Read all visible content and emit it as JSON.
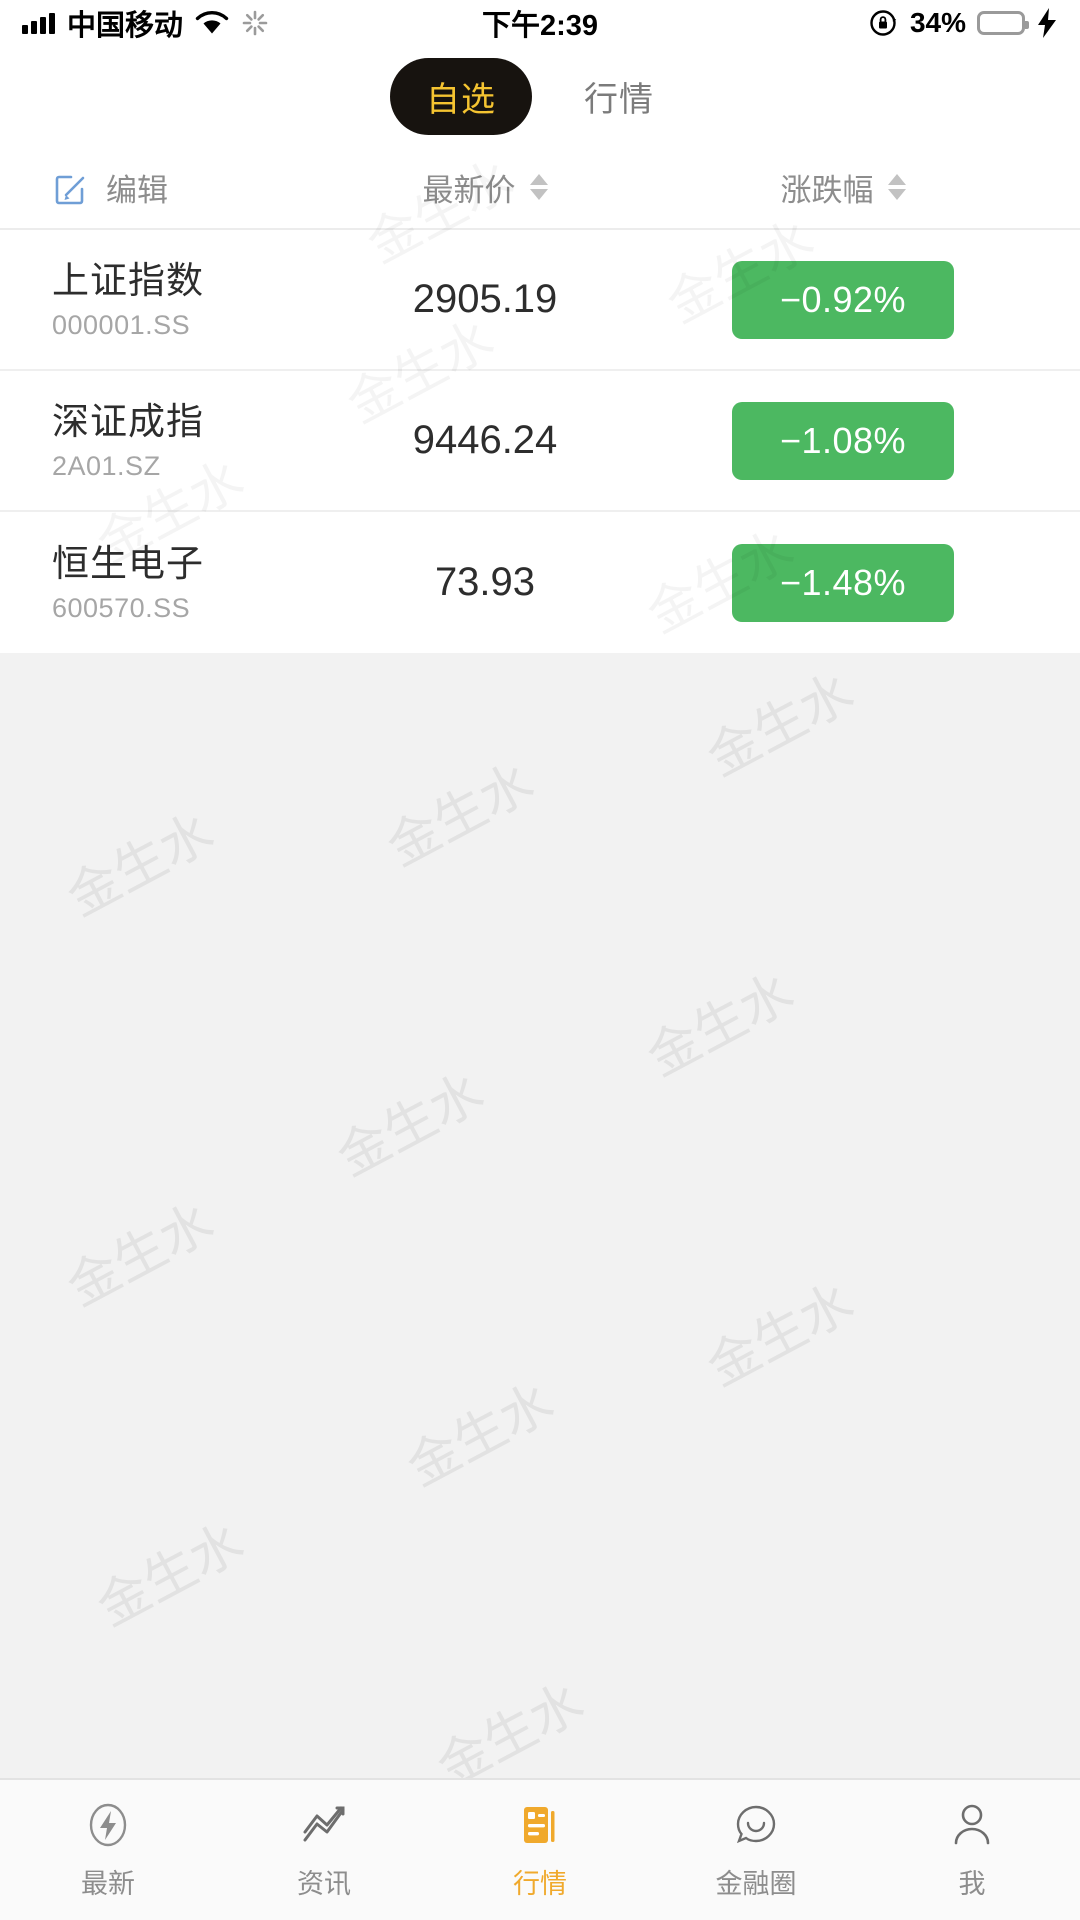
{
  "status_bar": {
    "carrier": "中国移动",
    "time": "下午2:39",
    "battery_percent": "34%",
    "battery_level": 34,
    "icons": [
      "signal-bars-icon",
      "wifi-icon",
      "sync-icon",
      "rotation-lock-icon",
      "battery-icon",
      "charging-bolt-icon"
    ]
  },
  "top_tabs": {
    "items": [
      {
        "label": "自选",
        "active": true
      },
      {
        "label": "行情",
        "active": false
      }
    ],
    "active_bg": "#17130f",
    "active_color": "#f5c431"
  },
  "column_header": {
    "edit_label": "编辑",
    "price_label": "最新价",
    "change_label": "涨跌幅"
  },
  "watchlist": {
    "rows": [
      {
        "name": "上证指数",
        "code": "000001.SS",
        "price": "2905.19",
        "change": "−0.92%",
        "change_color": "#4cb861"
      },
      {
        "name": "深证成指",
        "code": "2A01.SZ",
        "price": "9446.24",
        "change": "−1.08%",
        "change_color": "#4cb861"
      },
      {
        "name": "恒生电子",
        "code": "600570.SS",
        "price": "73.93",
        "change": "−1.48%",
        "change_color": "#4cb861"
      }
    ]
  },
  "watermark": {
    "text": "金生水"
  },
  "bottom_nav": {
    "items": [
      {
        "label": "最新",
        "icon": "lightning-circle-icon",
        "active": false
      },
      {
        "label": "资讯",
        "icon": "line-chart-icon",
        "active": false
      },
      {
        "label": "行情",
        "icon": "quotes-document-icon",
        "active": true
      },
      {
        "label": "金融圈",
        "icon": "chat-bubble-icon",
        "active": false
      },
      {
        "label": "我",
        "icon": "person-icon",
        "active": false
      }
    ],
    "active_color": "#f0a92c"
  }
}
